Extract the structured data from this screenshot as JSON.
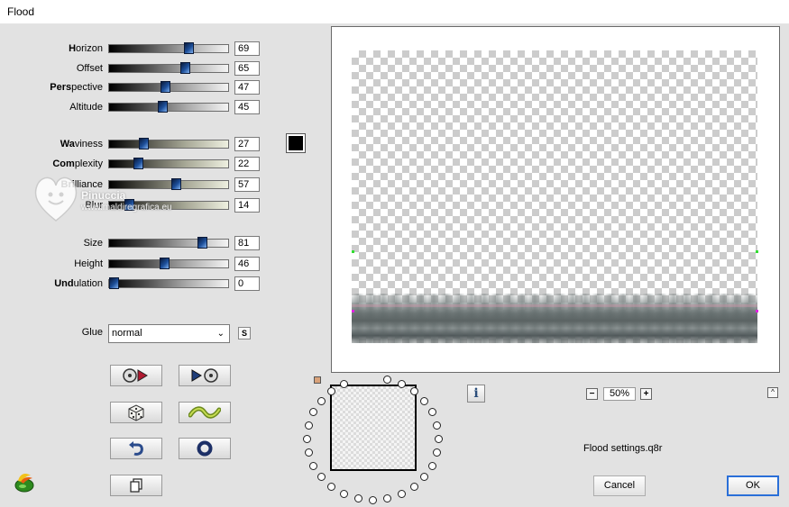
{
  "window": {
    "title": "Flood"
  },
  "sliders": [
    {
      "label": "Horizon",
      "accel": "H",
      "rest": "orizon",
      "value": "69",
      "fraction": 0.69,
      "style": "grey"
    },
    {
      "label": "Offset",
      "accel": "",
      "rest": "Offset",
      "value": "65",
      "fraction": 0.65,
      "style": "grey"
    },
    {
      "label": "Perspective",
      "accel": "Pers",
      "rest": "pective",
      "value": "47",
      "fraction": 0.47,
      "style": "grey"
    },
    {
      "label": "Altitude",
      "accel": "",
      "rest": "Altitude",
      "value": "45",
      "fraction": 0.45,
      "style": "grey"
    },
    {
      "label": "Waviness",
      "accel": "Wa",
      "rest": "viness",
      "value": "27",
      "fraction": 0.27,
      "style": "green"
    },
    {
      "label": "Complexity",
      "accel": "Com",
      "rest": "plexity",
      "value": "22",
      "fraction": 0.22,
      "style": "green"
    },
    {
      "label": "Brilliance",
      "accel": "Bri",
      "rest": "lliance",
      "value": "57",
      "fraction": 0.57,
      "style": "green"
    },
    {
      "label": "Blur",
      "accel": "",
      "rest": "Blur",
      "value": "14",
      "fraction": 0.14,
      "style": "green"
    },
    {
      "label": "Size",
      "accel": "",
      "rest": "Size",
      "value": "81",
      "fraction": 0.81,
      "style": "grey"
    },
    {
      "label": "Height",
      "accel": "",
      "rest": "Height",
      "value": "46",
      "fraction": 0.46,
      "style": "grey"
    },
    {
      "label": "Undulation",
      "accel": "Und",
      "rest": "ulation",
      "value": "0",
      "fraction": 0.0,
      "style": "grey"
    }
  ],
  "color_swatch": {
    "color": "#000000"
  },
  "watermark": {
    "line1": "Pinuccia",
    "line2": "www.maldiregrafica.eu"
  },
  "glue": {
    "label": "Glue",
    "value": "normal",
    "s_label": "S"
  },
  "tool_buttons": [
    {
      "name": "preset-backward-button",
      "icon": "disc-play-back-icon"
    },
    {
      "name": "preset-forward-button",
      "icon": "play-disc-icon"
    },
    {
      "name": "randomize-button",
      "icon": "dice-icon"
    },
    {
      "name": "wave-button",
      "icon": "wave-icon"
    },
    {
      "name": "reset-button",
      "icon": "undo-icon"
    },
    {
      "name": "default-button",
      "icon": "ring-icon"
    },
    {
      "name": "copy-button",
      "icon": "copy-icon"
    }
  ],
  "preview": {
    "zoom": "50%",
    "zoom_minus": "−",
    "zoom_plus": "+",
    "collapse": "^",
    "info": "i"
  },
  "settings_file": "Flood settings.q8r",
  "buttons": {
    "cancel": "Cancel",
    "ok": "OK"
  },
  "colors": {
    "thumb": "#1d4f9a",
    "ok_border": "#2a6fd8",
    "handle_green": "#33dd33",
    "handle_magenta": "#e020e0"
  }
}
